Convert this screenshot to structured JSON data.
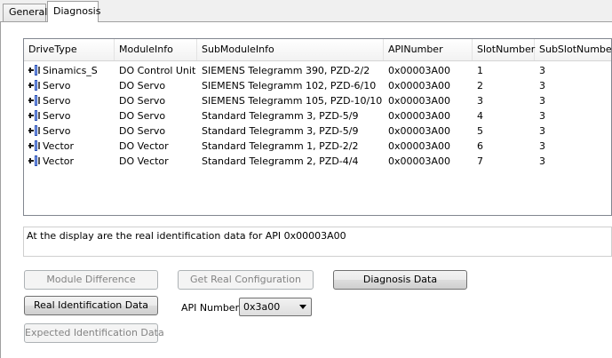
{
  "tabs": [
    {
      "label": "General"
    },
    {
      "label": "Diagnosis"
    }
  ],
  "grid": {
    "columns": [
      "DriveType",
      "ModuleInfo",
      "SubModuleInfo",
      "APINumber",
      "SlotNumber",
      "SubSlotNumber"
    ],
    "rows": [
      [
        "Sinamics_S",
        "DO Control Unit",
        "SIEMENS Telegramm 390, PZD-2/2",
        "0x00003A00",
        "1",
        "3"
      ],
      [
        "Servo",
        "DO Servo",
        "SIEMENS Telegramm 102, PZD-6/10",
        "0x00003A00",
        "2",
        "3"
      ],
      [
        "Servo",
        "DO Servo",
        "SIEMENS Telegramm 105, PZD-10/10",
        "0x00003A00",
        "3",
        "3"
      ],
      [
        "Servo",
        "DO Servo",
        "Standard Telegramm 3, PZD-5/9",
        "0x00003A00",
        "4",
        "3"
      ],
      [
        "Servo",
        "DO Servo",
        "Standard Telegramm 3, PZD-5/9",
        "0x00003A00",
        "5",
        "3"
      ],
      [
        "Vector",
        "DO Vector",
        "Standard Telegramm 1, PZD-2/2",
        "0x00003A00",
        "6",
        "3"
      ],
      [
        "Vector",
        "DO Vector",
        "Standard Telegramm 2, PZD-4/4",
        "0x00003A00",
        "7",
        "3"
      ]
    ]
  },
  "message": "At the display are the real identification data for API 0x00003A00",
  "buttons": {
    "module_difference": "Module Difference",
    "get_real_configuration": "Get Real Configuration",
    "diagnosis_data": "Diagnosis Data",
    "real_identification_data": "Real Identification Data",
    "expected_identification_data": "Expected Identification Data"
  },
  "api": {
    "label": "API Number",
    "selected": "0x3a00"
  },
  "icons": {
    "drive": "drive-icon"
  }
}
